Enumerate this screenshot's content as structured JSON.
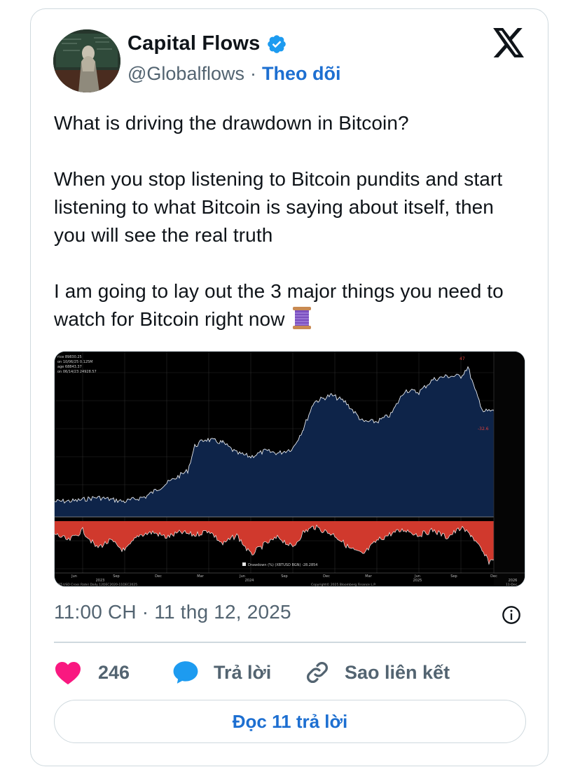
{
  "author": {
    "display_name": "Capital Flows",
    "handle": "@Globalflows",
    "separator": "·",
    "follow_label": "Theo dõi"
  },
  "tweet": {
    "paragraphs": [
      "What is driving the drawdown in Bitcoin?",
      "When you stop listening to Bitcoin pundits and start listening to what Bitcoin is saying about itself, then you will see the real truth",
      "I am going to lay out the 3 major things you need to watch for Bitcoin right now"
    ],
    "emoji_icon": "thread-spool-icon"
  },
  "chart_image": {
    "legend_lines": [
      "rice    89830.25",
      "on 10/06/25    0.125M",
      "age    68843.37",
      "on 06/14/23  24928.57"
    ],
    "peak_label": "47",
    "drawdown_pct_label": "-32.6",
    "drawdown_legend": "Drawdown (%) (XBTUSD BGN)  -28.2854",
    "month_ticks": [
      "Jun",
      "Sep",
      "Dec",
      "Mar",
      "Jun",
      "Sep",
      "Dec",
      "Mar",
      "Jun",
      "Sep",
      "Dec"
    ],
    "year_ticks": [
      "2023",
      "2024",
      "2025",
      "2026"
    ],
    "footer_left": "XBT-USD Cross Rate) Daily 12DEC2020-11DEC2025",
    "footer_center": "Copyright© 2025 Bloomberg Finance L.P.",
    "footer_right": "11-Dec",
    "colors": {
      "price_fill": "#0e2449",
      "price_line": "#e6eaf0",
      "drawdown_fill": "#d0392d",
      "background": "#000000"
    }
  },
  "meta": {
    "timestamp": "11:00 CH · 11 thg 12, 2025"
  },
  "actions": {
    "like_count": "246",
    "reply_label": "Trả lời",
    "copy_link_label": "Sao liên kết"
  },
  "read_replies_label": "Đọc 11 trả lời",
  "colors": {
    "accent": "#1d6fd1",
    "verified": "#1d9bf0",
    "heart": "#f91880",
    "muted": "#536471",
    "border": "#cfd9de"
  }
}
